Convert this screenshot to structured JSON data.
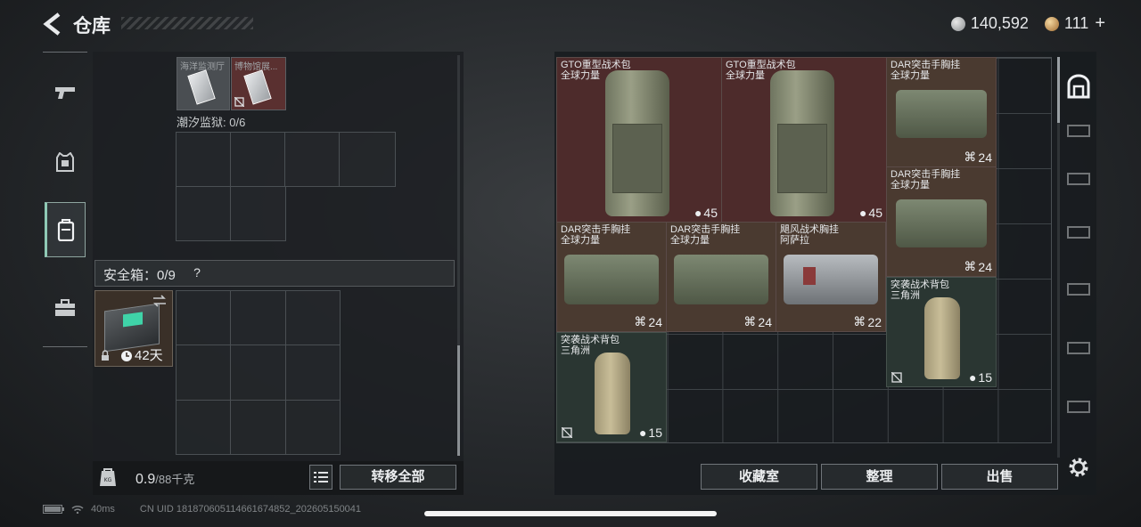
{
  "header": {
    "title": "仓库",
    "currency_silver": "140,592",
    "currency_gold": "111"
  },
  "left_panel": {
    "small_items": [
      {
        "label": "海洋监测厅"
      },
      {
        "label": "博物馆展..."
      }
    ],
    "tide_prison_label": "潮汐监狱: 0/6",
    "safe_box_label": "安全箱：0/9",
    "safe_box_help": "?",
    "safe_case_days": "42天",
    "weight_value": "0.9",
    "weight_unit": "/88千克",
    "transfer_all": "转移全部"
  },
  "storage_items": [
    {
      "name": "GTO重型战术包",
      "sub": "全球力量",
      "count": "45",
      "color": "red"
    },
    {
      "name": "GTO重型战术包",
      "sub": "全球力量",
      "count": "45",
      "color": "red"
    },
    {
      "name": "DAR突击手胸挂",
      "sub": "全球力量",
      "count": "24",
      "color": "brown"
    },
    {
      "name": "DAR突击手胸挂",
      "sub": "全球力量",
      "count": "24",
      "color": "brown"
    },
    {
      "name": "DAR突击手胸挂",
      "sub": "全球力量",
      "count": "24",
      "color": "brown"
    },
    {
      "name": "DAR突击手胸挂",
      "sub": "全球力量",
      "count": "24",
      "color": "brown"
    },
    {
      "name": "飓风战术胸挂",
      "sub": "阿萨拉",
      "count": "22",
      "color": "brown"
    },
    {
      "name": "突袭战术背包",
      "sub": "三角洲",
      "count": "15",
      "color": "dgreen"
    },
    {
      "name": "突袭战术背包",
      "sub": "三角洲",
      "count": "15",
      "color": "dgreen"
    }
  ],
  "right_buttons": {
    "collection": "收藏室",
    "organize": "整理",
    "sell": "出售"
  },
  "status": {
    "ping": "40ms",
    "uid": "CN UID 181870605114661674852_202605150041"
  }
}
